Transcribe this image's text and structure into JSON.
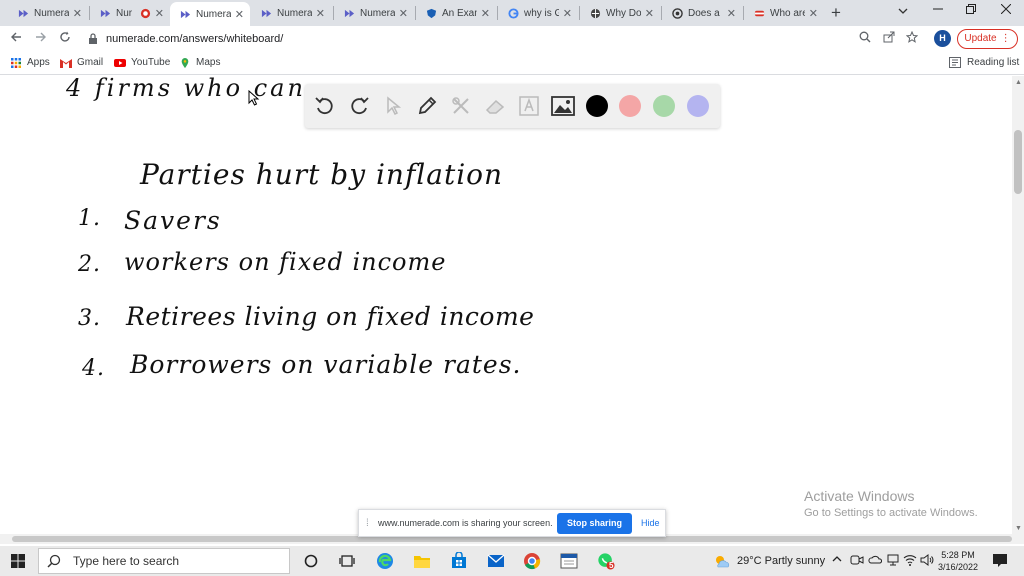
{
  "tabs": [
    {
      "label": "Numera",
      "icon": "numerade-icon"
    },
    {
      "label": "Nur",
      "icon": "numerade-icon",
      "recording": true
    },
    {
      "label": "Numera",
      "icon": "numerade-icon",
      "active": true
    },
    {
      "label": "Numera",
      "icon": "numerade-icon"
    },
    {
      "label": "Numera",
      "icon": "numerade-icon"
    },
    {
      "label": "An Exan",
      "icon": "shield-icon"
    },
    {
      "label": "why is G",
      "icon": "google-icon"
    },
    {
      "label": "Why Do",
      "icon": "globe-icon"
    },
    {
      "label": "Does a l",
      "icon": "circle-icon"
    },
    {
      "label": "Who are",
      "icon": "flag-icon"
    }
  ],
  "tab_close": "✕",
  "new_tab": "+",
  "address": {
    "url": "numerade.com/answers/whiteboard/"
  },
  "profile": {
    "initial": "H"
  },
  "update_button": "Update",
  "bookmarks": [
    {
      "label": "Apps",
      "icon": "apps-grid-icon"
    },
    {
      "label": "Gmail",
      "icon": "gmail-icon"
    },
    {
      "label": "YouTube",
      "icon": "youtube-icon"
    },
    {
      "label": "Maps",
      "icon": "maps-pin-icon"
    }
  ],
  "reading_list": "Reading list",
  "whiteboard": {
    "partial_line": "4  firms who can",
    "heading": "Parties hurt by inflation",
    "items": [
      {
        "num": "1.",
        "text": "Savers"
      },
      {
        "num": "2.",
        "text": "workers on fixed income"
      },
      {
        "num": "3.",
        "text": "Retirees living on fixed income"
      },
      {
        "num": "4.",
        "text": "Borrowers on variable rates."
      }
    ]
  },
  "toolbar": {
    "tools": [
      "undo-icon",
      "redo-icon",
      "pointer-icon",
      "pen-icon",
      "tools-icon",
      "eraser-icon",
      "text-icon",
      "image-icon"
    ],
    "colors": [
      "#000000",
      "#f4a6a6",
      "#a7d8a8",
      "#b4b4f0"
    ]
  },
  "sharing": {
    "message": "www.numerade.com is sharing your screen.",
    "stop_label": "Stop sharing",
    "hide_label": "Hide"
  },
  "activation": {
    "title": "Activate Windows",
    "subtitle": "Go to Settings to activate Windows."
  },
  "taskbar": {
    "search_placeholder": "Type here to search",
    "weather": "29°C  Partly sunny",
    "notification_badge": "5",
    "time": "5:28 PM",
    "date": "3/16/2022"
  }
}
